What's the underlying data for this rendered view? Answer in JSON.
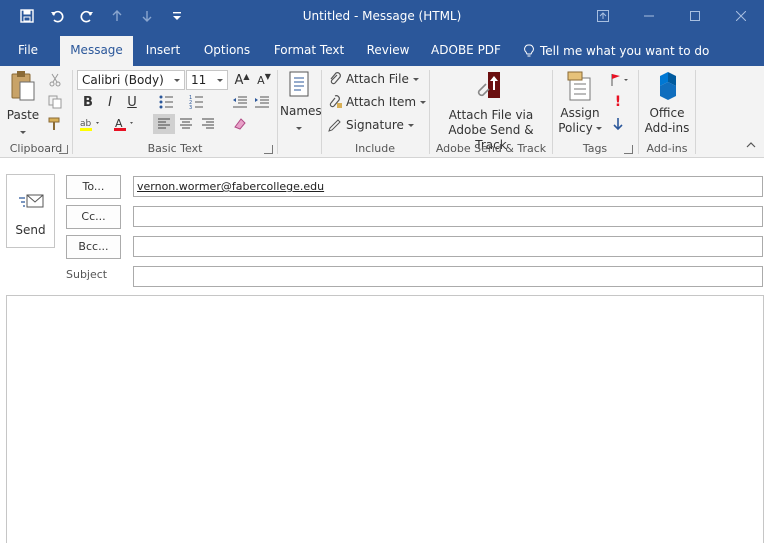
{
  "window": {
    "title": "Untitled  -  Message (HTML)",
    "title_bar_color": "#2b579a"
  },
  "quick_access": [
    "save-icon",
    "undo-icon",
    "redo-icon",
    "up-arrow-icon",
    "down-arrow-icon",
    "customize-icon"
  ],
  "tabs": [
    {
      "label": "File",
      "active": false
    },
    {
      "label": "Message",
      "active": true
    },
    {
      "label": "Insert",
      "active": false
    },
    {
      "label": "Options",
      "active": false
    },
    {
      "label": "Format Text",
      "active": false
    },
    {
      "label": "Review",
      "active": false
    },
    {
      "label": "ADOBE PDF",
      "active": false
    }
  ],
  "tell_me": "Tell me what you want to do",
  "ribbon": {
    "clipboard": {
      "label": "Clipboard",
      "paste": "Paste"
    },
    "basic_text": {
      "label": "Basic Text",
      "font": "Calibri (Body)",
      "size": "11",
      "bold": "B",
      "italic": "I",
      "underline": "U"
    },
    "names": {
      "label": "Names"
    },
    "include": {
      "label": "Include",
      "attach_file": "Attach File",
      "attach_item": "Attach Item",
      "signature": "Signature"
    },
    "adobe": {
      "label": "Adobe Send & Track",
      "button_line1": "Attach File via",
      "button_line2": "Adobe Send & Track"
    },
    "tags": {
      "label": "Tags",
      "assign_line1": "Assign",
      "assign_line2": "Policy"
    },
    "addins": {
      "label": "Add-ins",
      "line1": "Office",
      "line2": "Add-ins"
    }
  },
  "compose": {
    "send_label": "Send",
    "to_button": "To...",
    "cc_button": "Cc...",
    "bcc_button": "Bcc...",
    "subject_label": "Subject",
    "to_value": "vernon.wormer@fabercollege.edu",
    "cc_value": "",
    "bcc_value": "",
    "subject_value": ""
  }
}
